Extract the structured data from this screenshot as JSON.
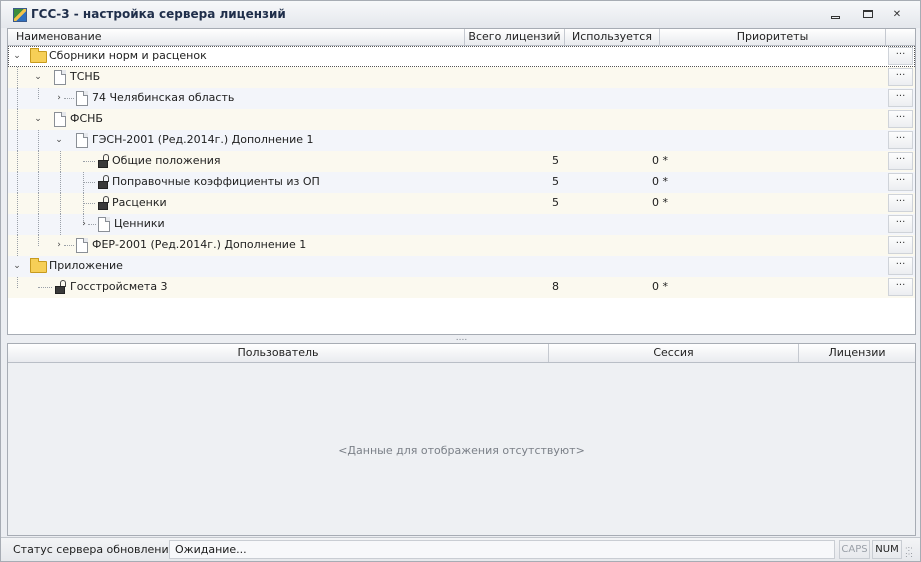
{
  "window": {
    "title": "ГСС-3 - настройка сервера лицензий",
    "minimize": "minimize",
    "maximize": "maximize",
    "close": "✕"
  },
  "top_grid": {
    "columns": {
      "name": "Наименование",
      "total": "Всего лицензий",
      "used": "Используется",
      "priorities": "Приоритеты"
    },
    "more_label": "···",
    "rows": [
      {
        "label": "Сборники норм и расценок",
        "total": "",
        "used": ""
      },
      {
        "label": "ТСНБ",
        "total": "",
        "used": ""
      },
      {
        "label": "74 Челябинская область",
        "total": "",
        "used": ""
      },
      {
        "label": "ФСНБ",
        "total": "",
        "used": ""
      },
      {
        "label": "ГЭСН-2001 (Ред.2014г.) Дополнение 1",
        "total": "",
        "used": ""
      },
      {
        "label": "Общие положения",
        "total": "5",
        "used": "0 *"
      },
      {
        "label": "Поправочные коэффициенты из ОП",
        "total": "5",
        "used": "0 *"
      },
      {
        "label": "Расценки",
        "total": "5",
        "used": "0 *"
      },
      {
        "label": "Ценники",
        "total": "",
        "used": ""
      },
      {
        "label": "ФЕР-2001 (Ред.2014г.) Дополнение 1",
        "total": "",
        "used": ""
      },
      {
        "label": "Приложение",
        "total": "",
        "used": ""
      },
      {
        "label": "Госстройсмета 3",
        "total": "8",
        "used": "0 *"
      }
    ]
  },
  "splitter": "....",
  "bottom_grid": {
    "columns": {
      "user": "Пользователь",
      "session": "Сессия",
      "licenses": "Лицензии"
    },
    "empty_text": "<Данные для отображения отсутствуют>"
  },
  "status_bar": {
    "label": "Статус сервера обновлений:",
    "value": "Ожидание...",
    "caps": "CAPS",
    "num": "NUM"
  }
}
